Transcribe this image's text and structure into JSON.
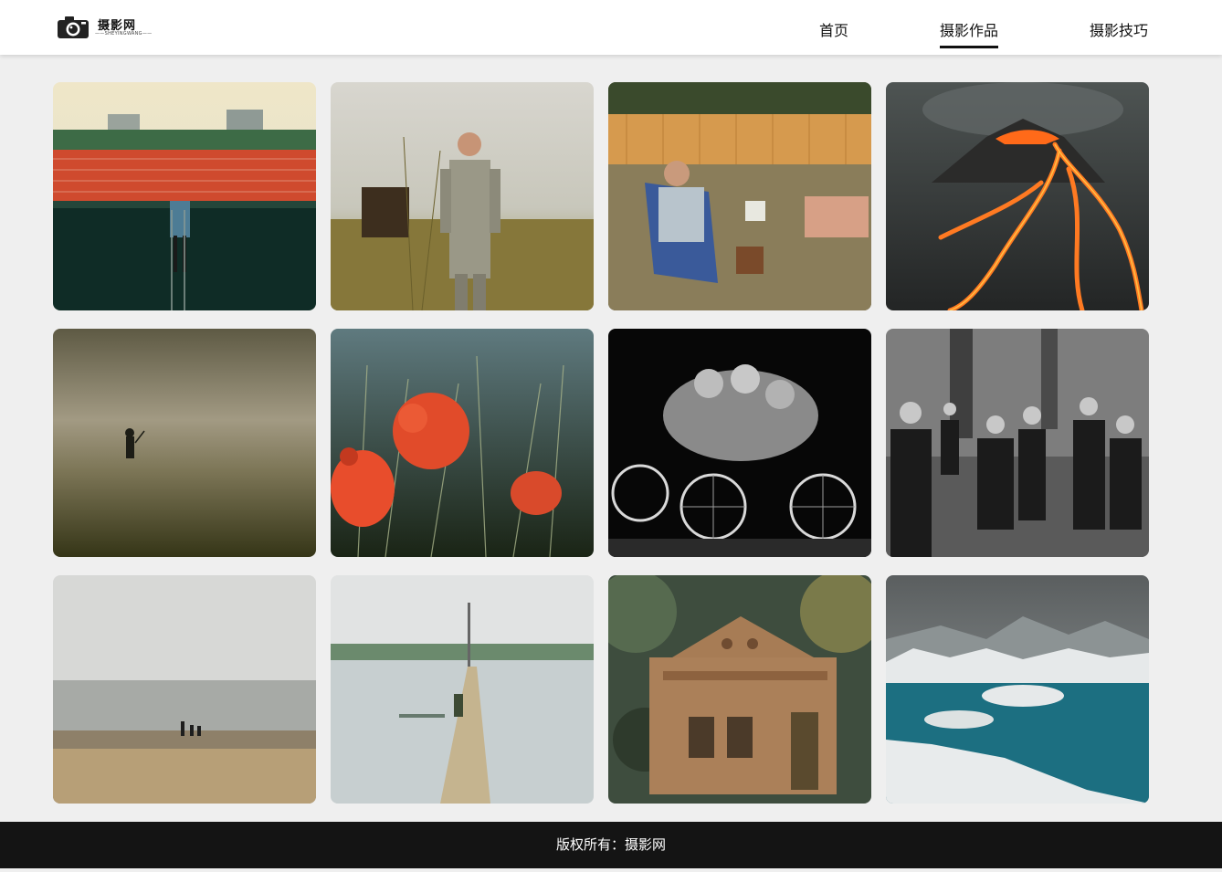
{
  "brand": {
    "name": "摄影网",
    "subtitle": "SHEYINGWANG"
  },
  "nav": [
    {
      "label": "首页",
      "active": false
    },
    {
      "label": "摄影作品",
      "active": true
    },
    {
      "label": "摄影技巧",
      "active": false
    }
  ],
  "gallery": [
    {
      "subject": "stadium-red-seats-climber"
    },
    {
      "subject": "beekeeper-in-meadow"
    },
    {
      "subject": "man-in-deckchair-with-hose"
    },
    {
      "subject": "volcano-lava-flow"
    },
    {
      "subject": "lone-figure-foggy-field"
    },
    {
      "subject": "red-poppies-in-grass"
    },
    {
      "subject": "wheelchair-athletes-embrace"
    },
    {
      "subject": "women-in-traditional-dress-forest"
    },
    {
      "subject": "figures-on-misty-beach"
    },
    {
      "subject": "path-through-flooded-fields"
    },
    {
      "subject": "abandoned-house-in-foliage"
    },
    {
      "subject": "snowy-mountains-fjord"
    }
  ],
  "footer": {
    "text": "版权所有：摄影网"
  }
}
